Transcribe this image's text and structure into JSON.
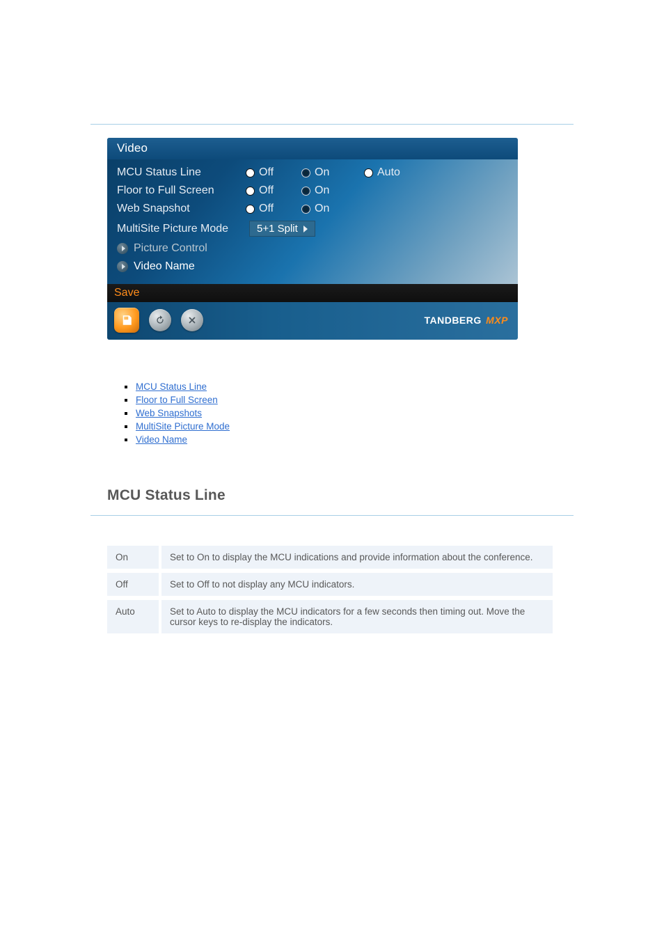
{
  "screenshot": {
    "title": "Video",
    "rows": [
      {
        "key": "mcu_status_line",
        "label": "MCU Status Line",
        "options": [
          {
            "text": "Off",
            "state": "hollow"
          },
          {
            "text": "On",
            "state": "dark"
          },
          {
            "text": "Auto",
            "state": "hollow"
          }
        ]
      },
      {
        "key": "floor_to_fullscreen",
        "label": "Floor to Full Screen",
        "options": [
          {
            "text": "Off",
            "state": "hollow"
          },
          {
            "text": "On",
            "state": "dark"
          }
        ]
      },
      {
        "key": "web_snapshot",
        "label": "Web Snapshot",
        "options": [
          {
            "text": "Off",
            "state": "hollow"
          },
          {
            "text": "On",
            "state": "dark"
          }
        ]
      }
    ],
    "picture_mode": {
      "label": "MultiSite Picture Mode",
      "value": "5+1 Split"
    },
    "menu_items": [
      {
        "key": "picture_control",
        "label": "Picture Control"
      },
      {
        "key": "video_name",
        "label": "Video Name"
      }
    ],
    "save_label": "Save",
    "brand": {
      "name": "TANDBERG",
      "suffix": "MXP"
    }
  },
  "links": [
    {
      "key": "mcu_status_line",
      "text": "MCU Status Line"
    },
    {
      "key": "floor_to_full_screen",
      "text": "Floor to Full Screen"
    },
    {
      "key": "web_snapshots",
      "text": "Web Snapshots"
    },
    {
      "key": "multisite_picture_mode",
      "text": "MultiSite Picture Mode"
    },
    {
      "key": "video_name",
      "text": "Video Name"
    }
  ],
  "subsection": {
    "title": "MCU Status Line",
    "rows": [
      {
        "k": "On",
        "v": "Set to On to display the MCU indications and provide information about the conference."
      },
      {
        "k": "Off",
        "v": "Set to Off to not display any MCU indicators."
      },
      {
        "k": "Auto",
        "v": "Set to Auto to display the MCU indicators for a few seconds then timing out. Move the cursor keys to re-display the indicators."
      }
    ]
  }
}
